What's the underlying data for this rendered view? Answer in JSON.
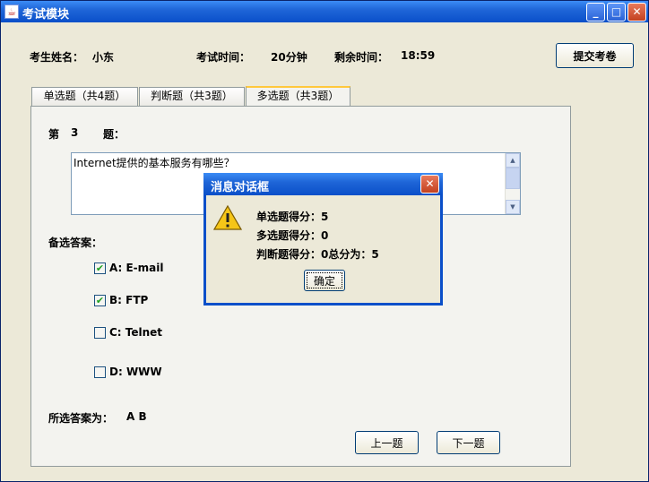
{
  "window": {
    "title": "考试模块",
    "app_icon": "java-cup-icon",
    "controls": {
      "minimize": "_",
      "maximize": "□",
      "close": "✕"
    }
  },
  "header": {
    "student_label": "考生姓名：",
    "student_name": "小东",
    "exam_time_label": "考试时间：",
    "exam_time_value": "20分钟",
    "remaining_label": "剩余时间：",
    "remaining_value": "18:59",
    "submit_label": "提交考卷"
  },
  "tabs": [
    {
      "label": "单选题（共4题）",
      "active": false
    },
    {
      "label": "判断题（共3题）",
      "active": false
    },
    {
      "label": "多选题（共3题）",
      "active": true
    }
  ],
  "question": {
    "prefix": "第",
    "number": "3",
    "suffix": "题：",
    "text": "Internet提供的基本服务有哪些？"
  },
  "answers": {
    "label": "备选答案：",
    "options": [
      {
        "label": "A:  E-mail",
        "checked": true
      },
      {
        "label": "B:  FTP",
        "checked": true
      },
      {
        "label": "C:  Telnet",
        "checked": false
      },
      {
        "label": "D:  WWW",
        "checked": false
      }
    ],
    "selected_label": "所选答案为：",
    "selected_value": "A B"
  },
  "nav": {
    "prev_label": "上一题",
    "next_label": "下一题"
  },
  "dialog": {
    "title": "消息对话框",
    "close": "✕",
    "icon": "warning-icon",
    "lines": [
      "单选题得分：5",
      "多选题得分：0",
      "判断题得分：0总分为：5"
    ],
    "ok_label": "确定"
  },
  "colors": {
    "titlebar": "#0a4fc9",
    "window_bg": "#ece9d8",
    "tab_highlight": "#ffc83c"
  }
}
